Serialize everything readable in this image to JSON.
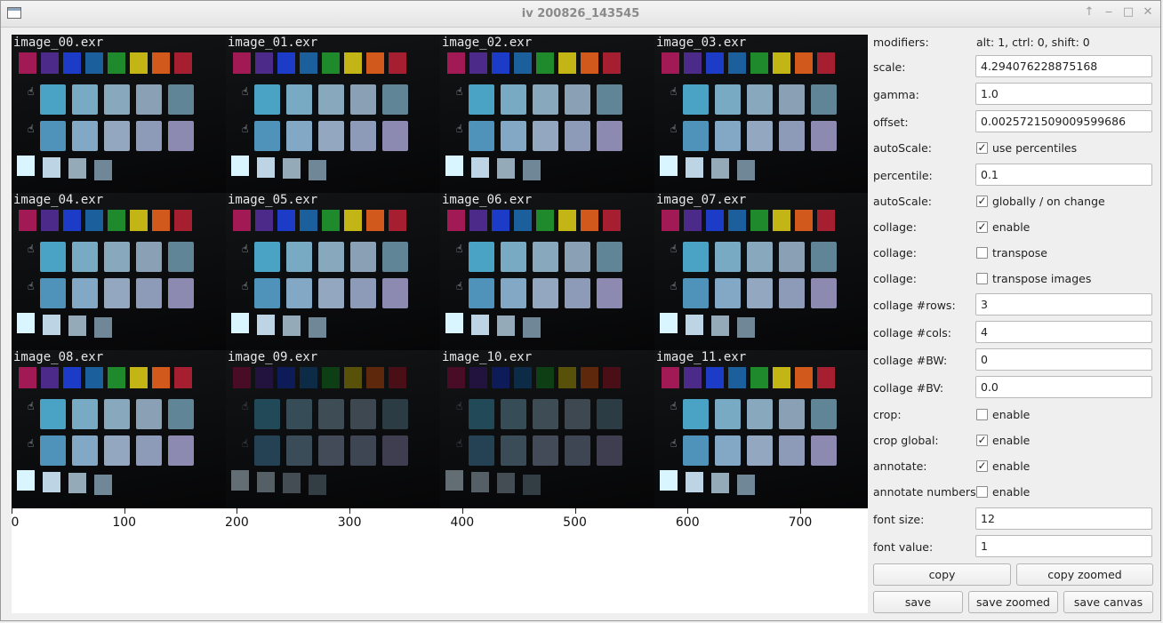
{
  "window": {
    "title": "iv 200826_143545"
  },
  "titlebar_icons": [
    "app-icon",
    "keep-above-icon",
    "minimize-icon",
    "maximize-icon",
    "close-icon"
  ],
  "collage": {
    "tiles": [
      "image_00.exr",
      "image_01.exr",
      "image_02.exr",
      "image_03.exr",
      "image_04.exr",
      "image_05.exr",
      "image_06.exr",
      "image_07.exr",
      "image_08.exr",
      "image_09.exr",
      "image_10.exr",
      "image_11.exr"
    ],
    "dim_tiles": [
      9,
      10
    ],
    "top_swatch_colors": [
      "#a11a55",
      "#4b2a8a",
      "#1c3bc6",
      "#1b5f9c",
      "#1f8a2c",
      "#c3b516",
      "#d1591b",
      "#a51f30"
    ],
    "patch_colors": [
      "#4aa3c4",
      "#79aac4",
      "#88a9bd",
      "#8aa0b4",
      "#5f8597",
      "#4f93bb",
      "#83a8c6",
      "#93a7c1",
      "#8d9bb8",
      "#8d8ab1"
    ],
    "white_patch_colors": [
      "#d9f5ff",
      "#bcd4e3",
      "#94aab8",
      "#6f8796"
    ],
    "axis_ticks": [
      "0",
      "100",
      "200",
      "300",
      "400",
      "500",
      "600",
      "700"
    ]
  },
  "panel": {
    "modifiers": {
      "label": "modifiers:",
      "value": "alt: 1, ctrl: 0, shift: 0"
    },
    "scale": {
      "label": "scale:",
      "value": "4.294076228875168"
    },
    "gamma": {
      "label": "gamma:",
      "value": "1.0"
    },
    "offset": {
      "label": "offset:",
      "value": "0.0025721509009599686"
    },
    "autoscale1": {
      "label": "autoScale:",
      "checked": true,
      "text": "use percentiles"
    },
    "percentile": {
      "label": "percentile:",
      "value": "0.1"
    },
    "autoscale2": {
      "label": "autoScale:",
      "checked": true,
      "text": "globally / on change"
    },
    "collage_enable": {
      "label": "collage:",
      "checked": true,
      "text": "enable"
    },
    "collage_transpose": {
      "label": "collage:",
      "checked": false,
      "text": "transpose"
    },
    "collage_transpose_images": {
      "label": "collage:",
      "checked": false,
      "text": "transpose images"
    },
    "rows": {
      "label": "collage #rows:",
      "value": "3"
    },
    "cols": {
      "label": "collage #cols:",
      "value": "4"
    },
    "bw": {
      "label": "collage #BW:",
      "value": "0"
    },
    "bv": {
      "label": "collage #BV:",
      "value": "0.0"
    },
    "crop": {
      "label": "crop:",
      "checked": false,
      "text": "enable"
    },
    "crop_global": {
      "label": "crop global:",
      "checked": true,
      "text": "enable"
    },
    "annotate": {
      "label": "annotate:",
      "checked": true,
      "text": "enable"
    },
    "annotate_numbers": {
      "label": "annotate numbers:",
      "checked": false,
      "text": "enable"
    },
    "font_size": {
      "label": "font size:",
      "value": "12"
    },
    "font_value": {
      "label": "font value:",
      "value": "1"
    },
    "buttons": {
      "copy": "copy",
      "copy_zoomed": "copy zoomed",
      "save": "save",
      "save_zoomed": "save zoomed",
      "save_canvas": "save canvas"
    }
  }
}
